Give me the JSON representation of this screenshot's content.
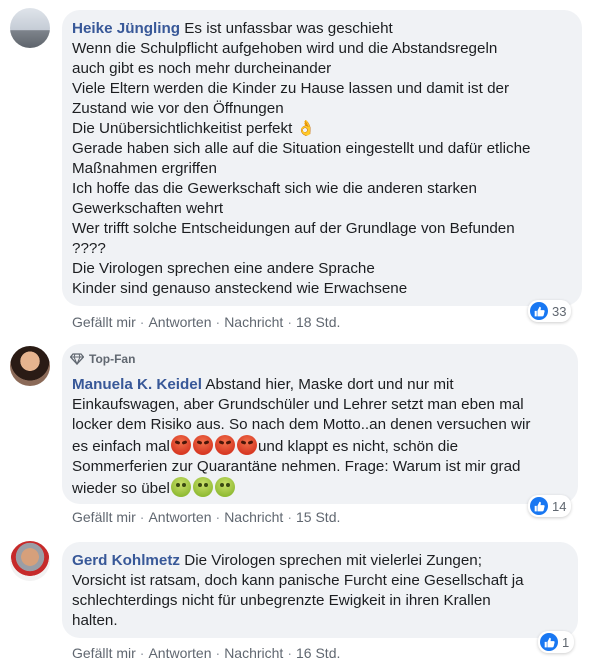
{
  "comments": [
    {
      "author": "Heike Jüngling",
      "text_lines": "Es ist unfassbar was geschieht\nWenn die Schulpflicht aufgehoben wird und die Abstandsregeln\nauch gibt es noch mehr durcheinander\nViele Eltern werden die Kinder zu Hause lassen und damit ist der\nZustand wie vor den Öffnungen\nDie Unübersichtlichkeitist perfekt",
      "text_after_emoji": "Gerade haben sich alle auf die Situation eingestellt und dafür etliche\nMaßnahmen ergriffen\nIch hoffe das die Gewerkschaft sich wie die anderen starken\nGewerkschaften wehrt\nWer trifft solche Entscheidungen auf der Grundlage von Befunden\n????\nDie Virologen sprechen eine andere Sprache\nKinder sind genauso ansteckend wie Erwachsene",
      "emoji": "ok-hand-emoji",
      "actions": {
        "like": "Gefällt mir",
        "reply": "Antworten",
        "message": "Nachricht",
        "time": "18 Std."
      },
      "reaction_count": "33"
    },
    {
      "badge": "Top-Fan",
      "author": "Manuela K. Keidel",
      "text_part1": "Abstand hier, Maske dort und nur mit\nEinkaufswagen, aber Grundschüler und Lehrer setzt man eben mal\nlocker dem Risiko aus. So nach dem Motto..an denen versuchen wir\nes einfach mal",
      "text_part2": "und klappt es nicht, schön die\nSommerferien zur Quarantäne nehmen. Frage: Warum ist mir grad\nwieder so übel",
      "emojis": [
        "angry-face-emoji",
        "nauseated-face-emoji"
      ],
      "actions": {
        "like": "Gefällt mir",
        "reply": "Antworten",
        "message": "Nachricht",
        "time": "15 Std."
      },
      "reaction_count": "14"
    },
    {
      "author": "Gerd Kohlmetz",
      "text": "Die Virologen sprechen mit vielerlei Zungen;\nVorsicht ist ratsam, doch kann panische Furcht eine Gesellschaft ja\nschlechterdings nicht für unbegrenzte Ewigkeit in ihren Krallen\nhalten.",
      "actions": {
        "like": "Gefällt mir",
        "reply": "Antworten",
        "message": "Nachricht",
        "time": "16 Std."
      },
      "reaction_count": "1"
    }
  ],
  "separator": "·",
  "colors": {
    "author": "#385898",
    "bubble": "#f0f2f5",
    "like": "#1877f2",
    "meta": "#606770"
  }
}
